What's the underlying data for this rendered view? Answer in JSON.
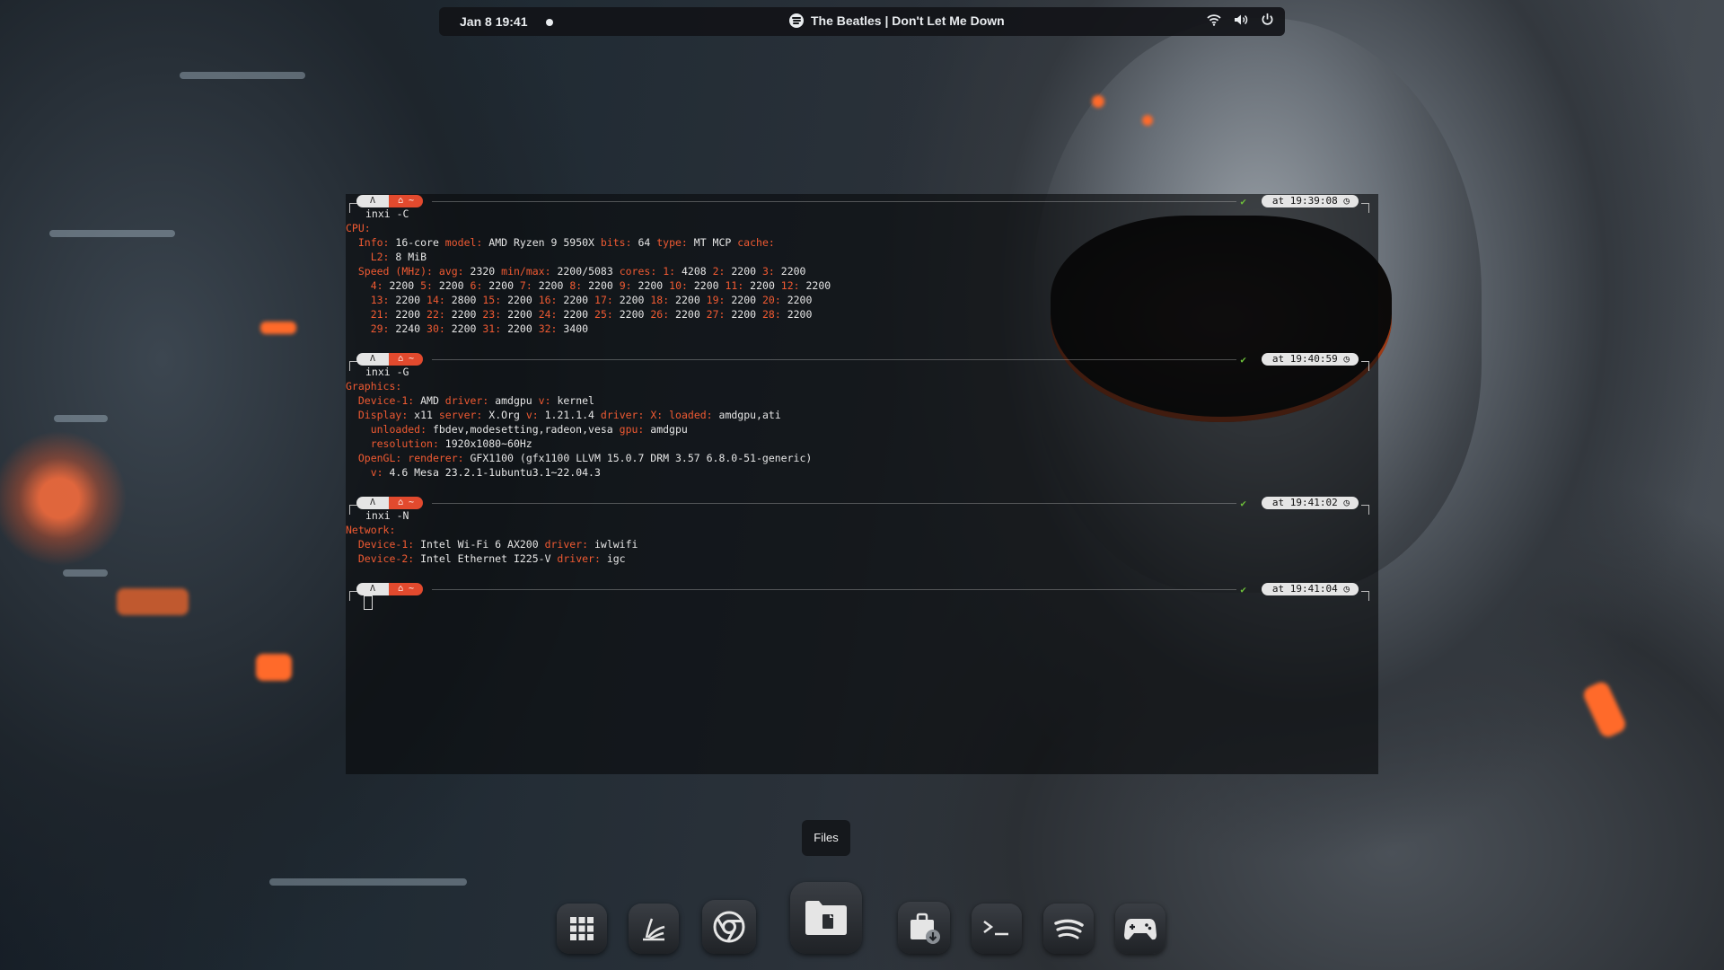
{
  "topbar": {
    "date": "Jan 8  19:41",
    "now_playing": "The Beatles | Don't Let Me Down"
  },
  "terminal": {
    "blocks": [
      {
        "command": "inxi -C",
        "time": "at 19:39:08",
        "lines": [
          [
            {
              "k": "CPU:"
            }
          ],
          [
            {
              "t": "  "
            },
            {
              "k": "Info:"
            },
            {
              "v": " 16-core "
            },
            {
              "k": "model:"
            },
            {
              "v": " AMD Ryzen 9 5950X "
            },
            {
              "k": "bits:"
            },
            {
              "v": " 64 "
            },
            {
              "k": "type:"
            },
            {
              "v": " MT MCP "
            },
            {
              "k": "cache:"
            }
          ],
          [
            {
              "t": "    "
            },
            {
              "k": "L2:"
            },
            {
              "v": " 8 MiB"
            }
          ],
          [
            {
              "t": "  "
            },
            {
              "k": "Speed (MHz):"
            },
            {
              "v": " "
            },
            {
              "k": "avg:"
            },
            {
              "v": " 2320 "
            },
            {
              "k": "min/max:"
            },
            {
              "v": " 2200/5083 "
            },
            {
              "k": "cores:"
            },
            {
              "v": " "
            },
            {
              "k": "1:"
            },
            {
              "v": " 4208 "
            },
            {
              "k": "2:"
            },
            {
              "v": " 2200 "
            },
            {
              "k": "3:"
            },
            {
              "v": " 2200"
            }
          ],
          [
            {
              "t": "    "
            },
            {
              "k": "4:"
            },
            {
              "v": " 2200 "
            },
            {
              "k": "5:"
            },
            {
              "v": " 2200 "
            },
            {
              "k": "6:"
            },
            {
              "v": " 2200 "
            },
            {
              "k": "7:"
            },
            {
              "v": " 2200 "
            },
            {
              "k": "8:"
            },
            {
              "v": " 2200 "
            },
            {
              "k": "9:"
            },
            {
              "v": " 2200 "
            },
            {
              "k": "10:"
            },
            {
              "v": " 2200 "
            },
            {
              "k": "11:"
            },
            {
              "v": " 2200 "
            },
            {
              "k": "12:"
            },
            {
              "v": " 2200"
            }
          ],
          [
            {
              "t": "    "
            },
            {
              "k": "13:"
            },
            {
              "v": " 2200 "
            },
            {
              "k": "14:"
            },
            {
              "v": " 2800 "
            },
            {
              "k": "15:"
            },
            {
              "v": " 2200 "
            },
            {
              "k": "16:"
            },
            {
              "v": " 2200 "
            },
            {
              "k": "17:"
            },
            {
              "v": " 2200 "
            },
            {
              "k": "18:"
            },
            {
              "v": " 2200 "
            },
            {
              "k": "19:"
            },
            {
              "v": " 2200 "
            },
            {
              "k": "20:"
            },
            {
              "v": " 2200"
            }
          ],
          [
            {
              "t": "    "
            },
            {
              "k": "21:"
            },
            {
              "v": " 2200 "
            },
            {
              "k": "22:"
            },
            {
              "v": " 2200 "
            },
            {
              "k": "23:"
            },
            {
              "v": " 2200 "
            },
            {
              "k": "24:"
            },
            {
              "v": " 2200 "
            },
            {
              "k": "25:"
            },
            {
              "v": " 2200 "
            },
            {
              "k": "26:"
            },
            {
              "v": " 2200 "
            },
            {
              "k": "27:"
            },
            {
              "v": " 2200 "
            },
            {
              "k": "28:"
            },
            {
              "v": " 2200"
            }
          ],
          [
            {
              "t": "    "
            },
            {
              "k": "29:"
            },
            {
              "v": " 2240 "
            },
            {
              "k": "30:"
            },
            {
              "v": " 2200 "
            },
            {
              "k": "31:"
            },
            {
              "v": " 2200 "
            },
            {
              "k": "32:"
            },
            {
              "v": " 3400"
            }
          ]
        ]
      },
      {
        "command": "inxi -G",
        "time": "at 19:40:59",
        "lines": [
          [
            {
              "k": "Graphics:"
            }
          ],
          [
            {
              "t": "  "
            },
            {
              "k": "Device-1:"
            },
            {
              "v": " AMD "
            },
            {
              "k": "driver:"
            },
            {
              "v": " amdgpu "
            },
            {
              "k": "v:"
            },
            {
              "v": " kernel"
            }
          ],
          [
            {
              "t": "  "
            },
            {
              "k": "Display:"
            },
            {
              "v": " x11 "
            },
            {
              "k": "server:"
            },
            {
              "v": " X.Org "
            },
            {
              "k": "v:"
            },
            {
              "v": " 1.21.1.4 "
            },
            {
              "k": "driver:"
            },
            {
              "v": " "
            },
            {
              "k": "X:"
            },
            {
              "v": " "
            },
            {
              "k": "loaded:"
            },
            {
              "v": " amdgpu,ati"
            }
          ],
          [
            {
              "t": "    "
            },
            {
              "k": "unloaded:"
            },
            {
              "v": " fbdev,modesetting,radeon,vesa "
            },
            {
              "k": "gpu:"
            },
            {
              "v": " amdgpu"
            }
          ],
          [
            {
              "t": "    "
            },
            {
              "k": "resolution:"
            },
            {
              "v": " 1920x1080~60Hz"
            }
          ],
          [
            {
              "t": "  "
            },
            {
              "k": "OpenGL:"
            },
            {
              "v": " "
            },
            {
              "k": "renderer:"
            },
            {
              "v": " GFX1100 (gfx1100 LLVM 15.0.7 DRM 3.57 6.8.0-51-generic)"
            }
          ],
          [
            {
              "t": "    "
            },
            {
              "k": "v:"
            },
            {
              "v": " 4.6 Mesa 23.2.1-1ubuntu3.1~22.04.3"
            }
          ]
        ]
      },
      {
        "command": "inxi -N",
        "time": "at 19:41:02",
        "lines": [
          [
            {
              "k": "Network:"
            }
          ],
          [
            {
              "t": "  "
            },
            {
              "k": "Device-1:"
            },
            {
              "v": " Intel Wi-Fi 6 AX200 "
            },
            {
              "k": "driver:"
            },
            {
              "v": " iwlwifi"
            }
          ],
          [
            {
              "t": "  "
            },
            {
              "k": "Device-2:"
            },
            {
              "v": " Intel Ethernet I225-V "
            },
            {
              "k": "driver:"
            },
            {
              "v": " igc"
            }
          ]
        ]
      },
      {
        "command": "",
        "time": "at 19:41:04",
        "lines": []
      }
    ]
  },
  "dock": {
    "tooltip": "Files",
    "items": [
      {
        "name": "app-grid-icon"
      },
      {
        "name": "app-launcher-icon"
      },
      {
        "name": "chrome-icon"
      },
      {
        "name": "files-icon"
      },
      {
        "name": "software-store-icon"
      },
      {
        "name": "terminal-icon"
      },
      {
        "name": "spotify-icon"
      },
      {
        "name": "gamepad-icon"
      }
    ]
  }
}
